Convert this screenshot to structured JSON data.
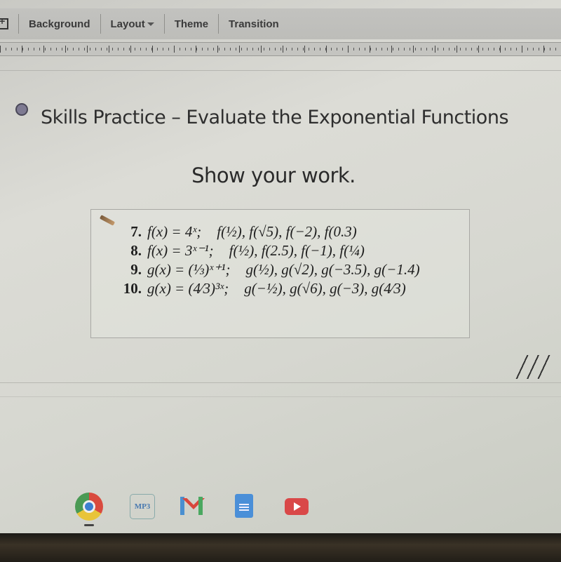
{
  "toolbar": {
    "items": [
      {
        "label": "Background",
        "has_dropdown": false
      },
      {
        "label": "Layout",
        "has_dropdown": true
      },
      {
        "label": "Theme",
        "has_dropdown": false
      },
      {
        "label": "Transition",
        "has_dropdown": false
      }
    ],
    "insert_icon": "add-box-icon"
  },
  "slide": {
    "bullet_title": "Skills Practice – Evaluate the Exponential Functions",
    "subtitle": "Show your work.",
    "problems": [
      {
        "number": "7.",
        "function": "f(x) = 4ˣ;",
        "evaluate": "f(½), f(√5), f(−2), f(0.3)"
      },
      {
        "number": "8.",
        "function": "f(x) = 3ˣ⁻¹;",
        "evaluate": "f(½), f(2.5), f(−1), f(¼)"
      },
      {
        "number": "9.",
        "function": "g(x) = (⅓)ˣ⁺¹;",
        "evaluate": "g(½), g(√2), g(−3.5), g(−1.4)"
      },
      {
        "number": "10.",
        "function": "g(x) = (4⁄3)³ˣ;",
        "evaluate": "g(−½), g(√6), g(−3), g(4⁄3)"
      }
    ],
    "decoration": "hatch-lines"
  },
  "shelf": {
    "apps": [
      {
        "name": "Chrome",
        "icon": "chrome-icon",
        "active": true
      },
      {
        "name": "MP3",
        "icon": "mp3-icon",
        "label": "MP3"
      },
      {
        "name": "Gmail",
        "icon": "gmail-icon"
      },
      {
        "name": "Docs",
        "icon": "docs-icon"
      },
      {
        "name": "YouTube",
        "icon": "youtube-icon"
      }
    ]
  }
}
